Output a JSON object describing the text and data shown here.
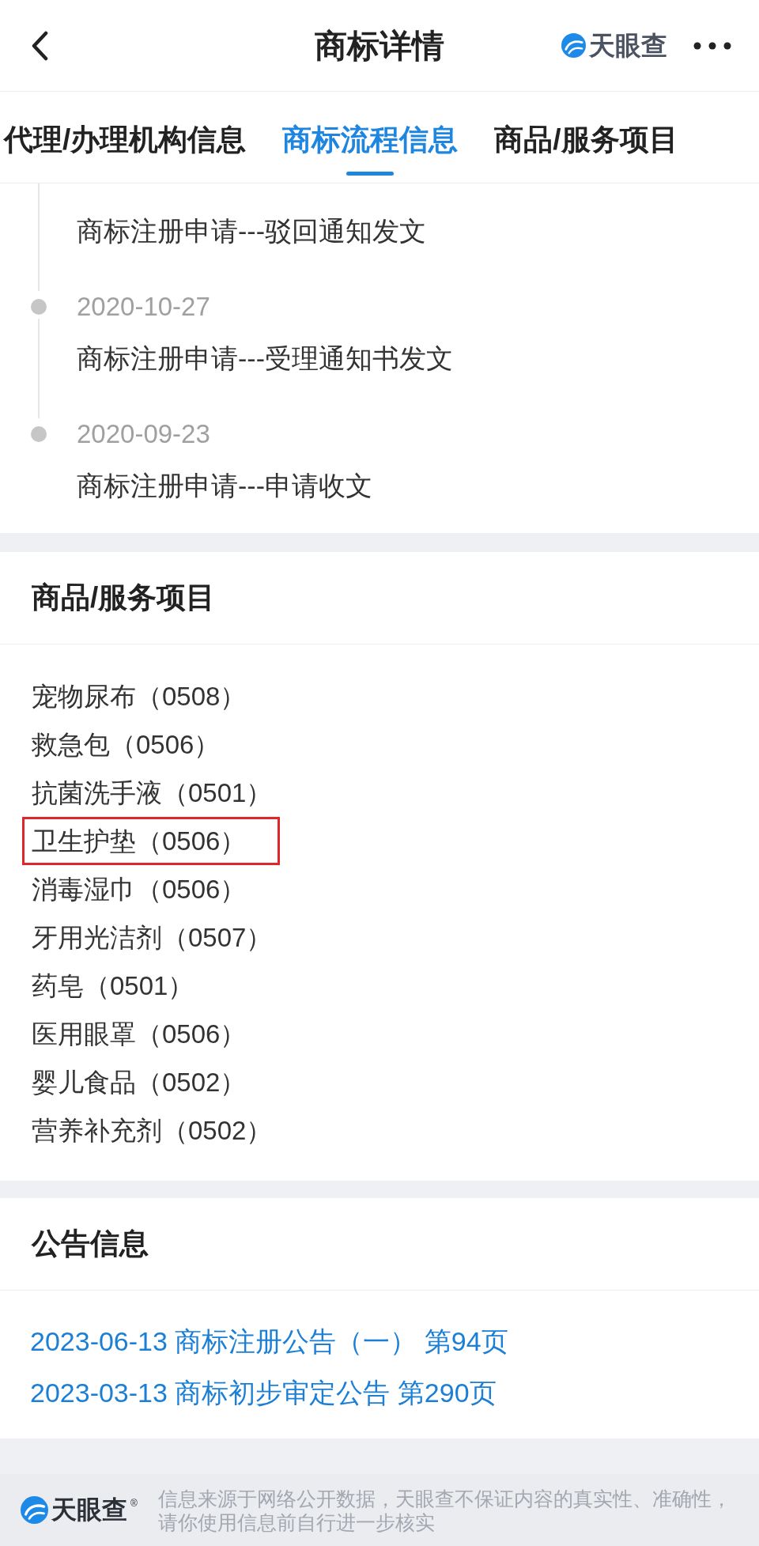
{
  "header": {
    "title": "商标详情",
    "brand": "天眼查"
  },
  "tabs": [
    {
      "label": "代理/办理机构信息",
      "selected": false
    },
    {
      "label": "商标流程信息",
      "selected": true
    },
    {
      "label": "商品/服务项目",
      "selected": false
    }
  ],
  "timeline": [
    {
      "title": "商标注册申请---驳回通知发文"
    },
    {
      "date": "2020-10-27",
      "title": "商标注册申请---受理通知书发文"
    },
    {
      "date": "2020-09-23",
      "title": "商标注册申请---申请收文"
    }
  ],
  "goods": {
    "heading": "商品/服务项目",
    "items": [
      {
        "name": "宠物尿布（0508）",
        "highlighted": false
      },
      {
        "name": "救急包（0506）",
        "highlighted": false
      },
      {
        "name": "抗菌洗手液（0501）",
        "highlighted": false
      },
      {
        "name": "卫生护垫（0506）",
        "highlighted": true
      },
      {
        "name": "消毒湿巾（0506）",
        "highlighted": false
      },
      {
        "name": "牙用光洁剂（0507）",
        "highlighted": false
      },
      {
        "name": "药皂（0501）",
        "highlighted": false
      },
      {
        "name": "医用眼罩（0506）",
        "highlighted": false
      },
      {
        "name": "婴儿食品（0502）",
        "highlighted": false
      },
      {
        "name": "营养补充剂（0502）",
        "highlighted": false
      }
    ]
  },
  "announcements": {
    "heading": "公告信息",
    "links": [
      "2023-06-13 商标注册公告（一） 第94页",
      "2023-03-13 商标初步审定公告 第290页"
    ]
  },
  "footer": {
    "brand": "天眼查",
    "brand_mark": "®",
    "disclaimer": "信息来源于网络公开数据，天眼查不保证内容的真实性、准确性，请你使用信息前自行进一步核实"
  }
}
